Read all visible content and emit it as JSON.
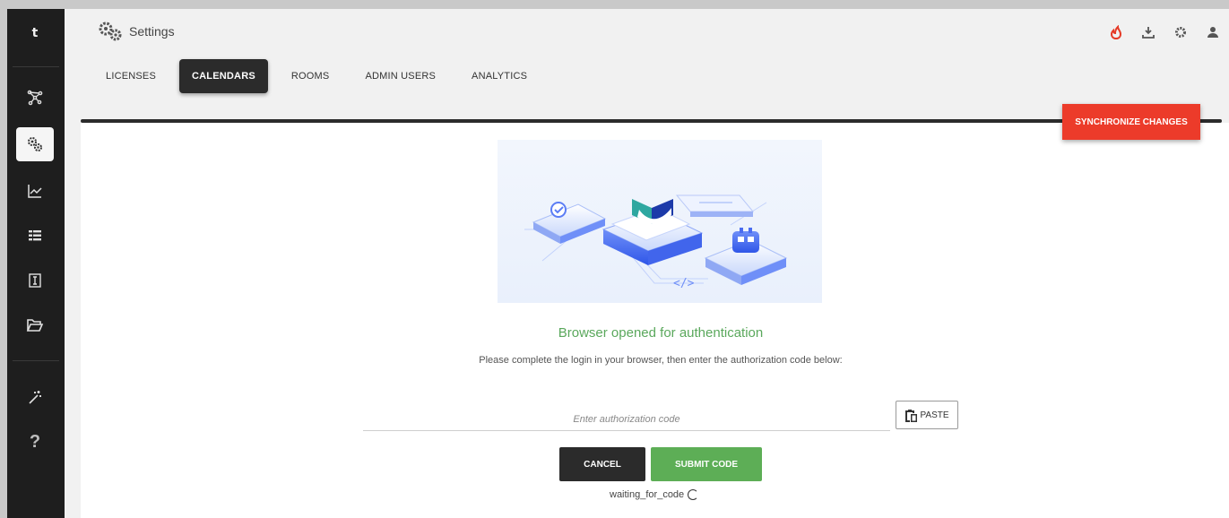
{
  "sidebar": {
    "letter": "t",
    "items": [
      {
        "icon": "network-icon"
      },
      {
        "icon": "gears-icon",
        "active": true
      },
      {
        "icon": "chart-line-icon"
      },
      {
        "icon": "list-icon"
      },
      {
        "icon": "text-cursor-icon"
      },
      {
        "icon": "folder-open-icon"
      },
      {
        "icon": "magic-wand-icon"
      },
      {
        "icon": "help-icon",
        "label": "?"
      }
    ]
  },
  "header": {
    "title": "Settings",
    "icons": [
      "fire-icon",
      "download-icon",
      "gear-icon",
      "user-icon"
    ]
  },
  "tabs": [
    {
      "label": "LICENSES"
    },
    {
      "label": "CALENDARS",
      "active": true
    },
    {
      "label": "ROOMS"
    },
    {
      "label": "ADMIN USERS"
    },
    {
      "label": "ANALYTICS"
    }
  ],
  "sync_button": "SYNCHRONIZE CHANGES",
  "auth": {
    "heading": "Browser opened for authentication",
    "subtext": "Please complete the login in your browser, then enter the authorization code below:",
    "code_placeholder": "Enter authorization code",
    "code_value": "",
    "paste_label": "PASTE",
    "cancel_label": "CANCEL",
    "submit_label": "SUBMIT CODE",
    "status": "waiting_for_code"
  },
  "colors": {
    "accent_red": "#ec3b2a",
    "accent_green": "#5dae56",
    "heading_green": "#5aa85c",
    "dark": "#2b2b2b"
  }
}
